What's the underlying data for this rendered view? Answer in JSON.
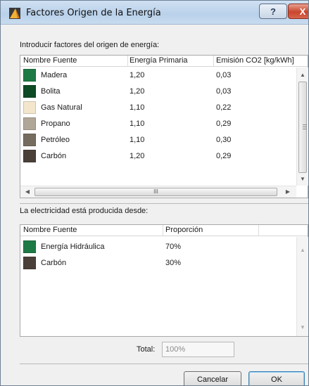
{
  "window": {
    "title": "Factores Origen de la Energía",
    "help_label": "?",
    "close_label": "X"
  },
  "sources_section": {
    "label": "Introducir factores del origen de energía:",
    "columns": [
      "Nombre Fuente",
      "Energía Primaria",
      "Emisión CO2 [kg/kWh]"
    ],
    "rows": [
      {
        "name": "Madera",
        "primary": "1,20",
        "co2": "0,03",
        "color": "#1e7a45"
      },
      {
        "name": "Bolita",
        "primary": "1,20",
        "co2": "0,03",
        "color": "#0d4a25"
      },
      {
        "name": "Gas Natural",
        "primary": "1,10",
        "co2": "0,22",
        "color": "#f4e6cc"
      },
      {
        "name": "Propano",
        "primary": "1,10",
        "co2": "0,29",
        "color": "#b1a798"
      },
      {
        "name": "Petróleo",
        "primary": "1,10",
        "co2": "0,30",
        "color": "#766c60"
      },
      {
        "name": "Carbón",
        "primary": "1,20",
        "co2": "0,29",
        "color": "#4a4039"
      }
    ],
    "hscroll_grip": "III"
  },
  "electricity_section": {
    "label": "La electricidad está producida desde:",
    "columns": [
      "Nombre Fuente",
      "Proporción"
    ],
    "rows": [
      {
        "name": "Energía Hidráulica",
        "proportion": "70%",
        "color": "#1e7a45"
      },
      {
        "name": "Carbón",
        "proportion": "30%",
        "color": "#4a4039"
      }
    ]
  },
  "total": {
    "label": "Total:",
    "value": "100%"
  },
  "buttons": {
    "cancel": "Cancelar",
    "ok": "OK"
  },
  "icons": {
    "app": "archicad-energy-icon",
    "scroll_up": "scroll-up-arrow-icon",
    "scroll_down": "scroll-down-arrow-icon",
    "scroll_left": "scroll-left-arrow-icon",
    "scroll_right": "scroll-right-arrow-icon"
  }
}
